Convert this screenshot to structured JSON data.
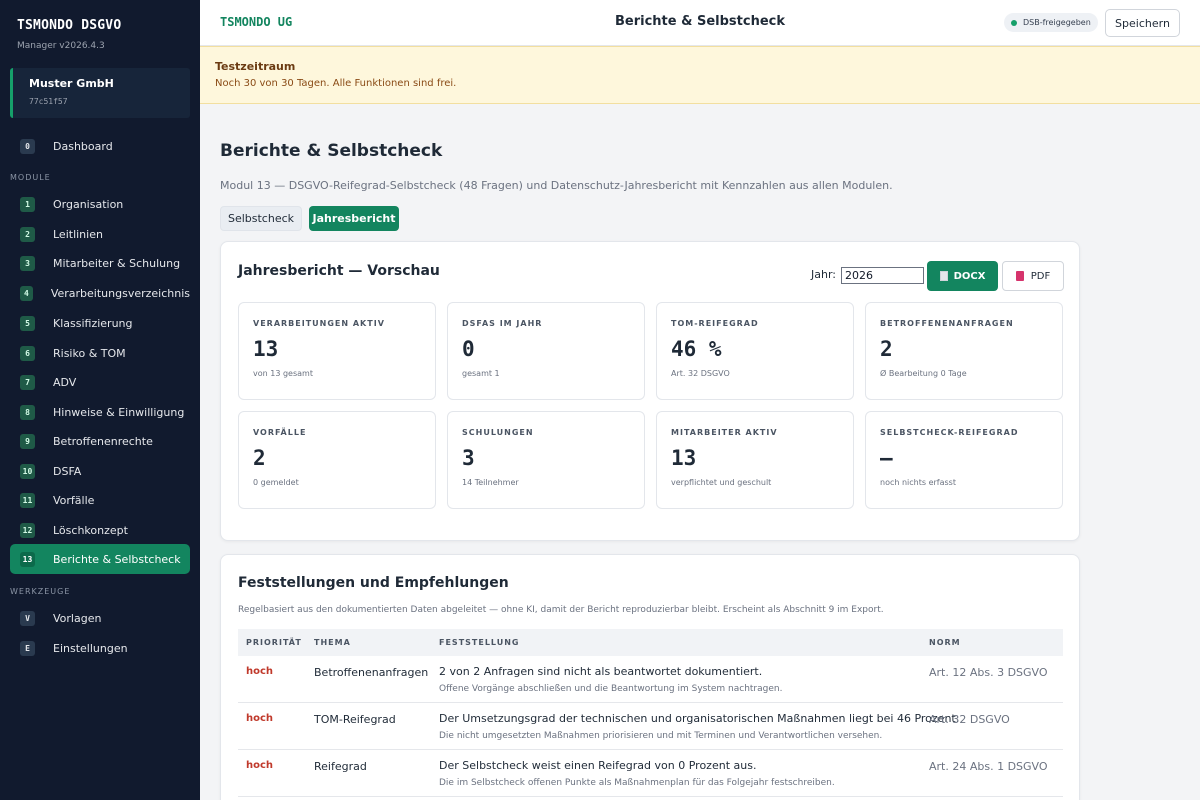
{
  "sidebar": {
    "brand": "TSMONDO DSGVO",
    "version": "Manager v2026.4.3",
    "org_name": "Muster GmbH",
    "org_id": "77c51f57",
    "dashboard": {
      "num": "0",
      "label": "Dashboard"
    },
    "section_module": "MODULE",
    "modules": [
      {
        "num": "1",
        "label": "Organisation"
      },
      {
        "num": "2",
        "label": "Leitlinien"
      },
      {
        "num": "3",
        "label": "Mitarbeiter & Schulung"
      },
      {
        "num": "4",
        "label": "Verarbeitungsverzeichnis"
      },
      {
        "num": "5",
        "label": "Klassifizierung"
      },
      {
        "num": "6",
        "label": "Risiko & TOM"
      },
      {
        "num": "7",
        "label": "ADV"
      },
      {
        "num": "8",
        "label": "Hinweise & Einwilligung"
      },
      {
        "num": "9",
        "label": "Betroffenenrechte"
      },
      {
        "num": "10",
        "label": "DSFA"
      },
      {
        "num": "11",
        "label": "Vorfälle"
      },
      {
        "num": "12",
        "label": "Löschkonzept"
      },
      {
        "num": "13",
        "label": "Berichte & Selbstcheck"
      }
    ],
    "section_tools": "WERKZEUGE",
    "tools": [
      {
        "num": "V",
        "label": "Vorlagen"
      },
      {
        "num": "E",
        "label": "Einstellungen"
      }
    ]
  },
  "topbar": {
    "org": "TSMONDO UG",
    "title": "Berichte & Selbstcheck",
    "dsb_badge": "DSB-freigegeben",
    "save_label": "Speichern"
  },
  "trial": {
    "title": "Testzeitraum",
    "text": "Noch 30 von 30 Tagen. Alle Funktionen sind frei."
  },
  "main": {
    "title": "Berichte & Selbstcheck",
    "subtitle": "Modul 13 — DSGVO-Reifegrad-Selbstcheck (48 Fragen) und Datenschutz-Jahresbericht mit Kennzahlen aus allen Modulen.",
    "tabs": [
      {
        "label": "Selbstcheck"
      },
      {
        "label": "Jahresbericht"
      }
    ]
  },
  "report": {
    "title": "Jahresbericht — Vorschau",
    "year_label": "Jahr:",
    "year_value": "2026",
    "docx_label": "DOCX",
    "pdf_label": "PDF",
    "stats": [
      {
        "label": "VERARBEITUNGEN AKTIV",
        "value": "13",
        "sub": "von 13 gesamt"
      },
      {
        "label": "DSFAS IM JAHR",
        "value": "0",
        "sub": "gesamt 1"
      },
      {
        "label": "TOM-REIFEGRAD",
        "value": "46 %",
        "sub": "Art. 32 DSGVO"
      },
      {
        "label": "BETROFFENENANFRAGEN",
        "value": "2",
        "sub": "Ø Bearbeitung 0 Tage"
      },
      {
        "label": "VORFÄLLE",
        "value": "2",
        "sub": "0 gemeldet"
      },
      {
        "label": "SCHULUNGEN",
        "value": "3",
        "sub": "14 Teilnehmer"
      },
      {
        "label": "MITARBEITER AKTIV",
        "value": "13",
        "sub": "verpflichtet und geschult"
      },
      {
        "label": "SELBSTCHECK-REIFEGRAD",
        "value": "—",
        "sub": "noch nichts erfasst"
      }
    ]
  },
  "findings": {
    "title": "Feststellungen und Empfehlungen",
    "note": "Regelbasiert aus den dokumentierten Daten abgeleitet — ohne KI, damit der Bericht reproduzierbar bleibt. Erscheint als Abschnitt 9 im Export.",
    "headers": {
      "prio": "PRIORITÄT",
      "thema": "THEMA",
      "fest": "FESTSTELLUNG",
      "norm": "NORM"
    },
    "rows": [
      {
        "prio": "hoch",
        "thema": "Betroffenenanfragen",
        "fest": "2 von 2 Anfragen sind nicht als beantwortet dokumentiert.",
        "hint": "Offene Vorgänge abschließen und die Beantwortung im System nachtragen.",
        "norm": "Art. 12 Abs. 3 DSGVO"
      },
      {
        "prio": "hoch",
        "thema": "TOM-Reifegrad",
        "fest": "Der Umsetzungsgrad der technischen und organisatorischen Maßnahmen liegt bei 46 Prozent.",
        "hint": "Die nicht umgesetzten Maßnahmen priorisieren und mit Terminen und Verantwortlichen versehen.",
        "norm": "Art. 32 DSGVO"
      },
      {
        "prio": "hoch",
        "thema": "Reifegrad",
        "fest": "Der Selbstcheck weist einen Reifegrad von 0 Prozent aus.",
        "hint": "Die im Selbstcheck offenen Punkte als Maßnahmenplan für das Folgejahr festschreiben.",
        "norm": "Art. 24 Abs. 1 DSGVO"
      }
    ]
  },
  "colors": {
    "sidebar_bg": "#111a2e",
    "accent": "#13855f",
    "priority_high": "#c0392b",
    "trial_bg": "#fef7dc"
  }
}
